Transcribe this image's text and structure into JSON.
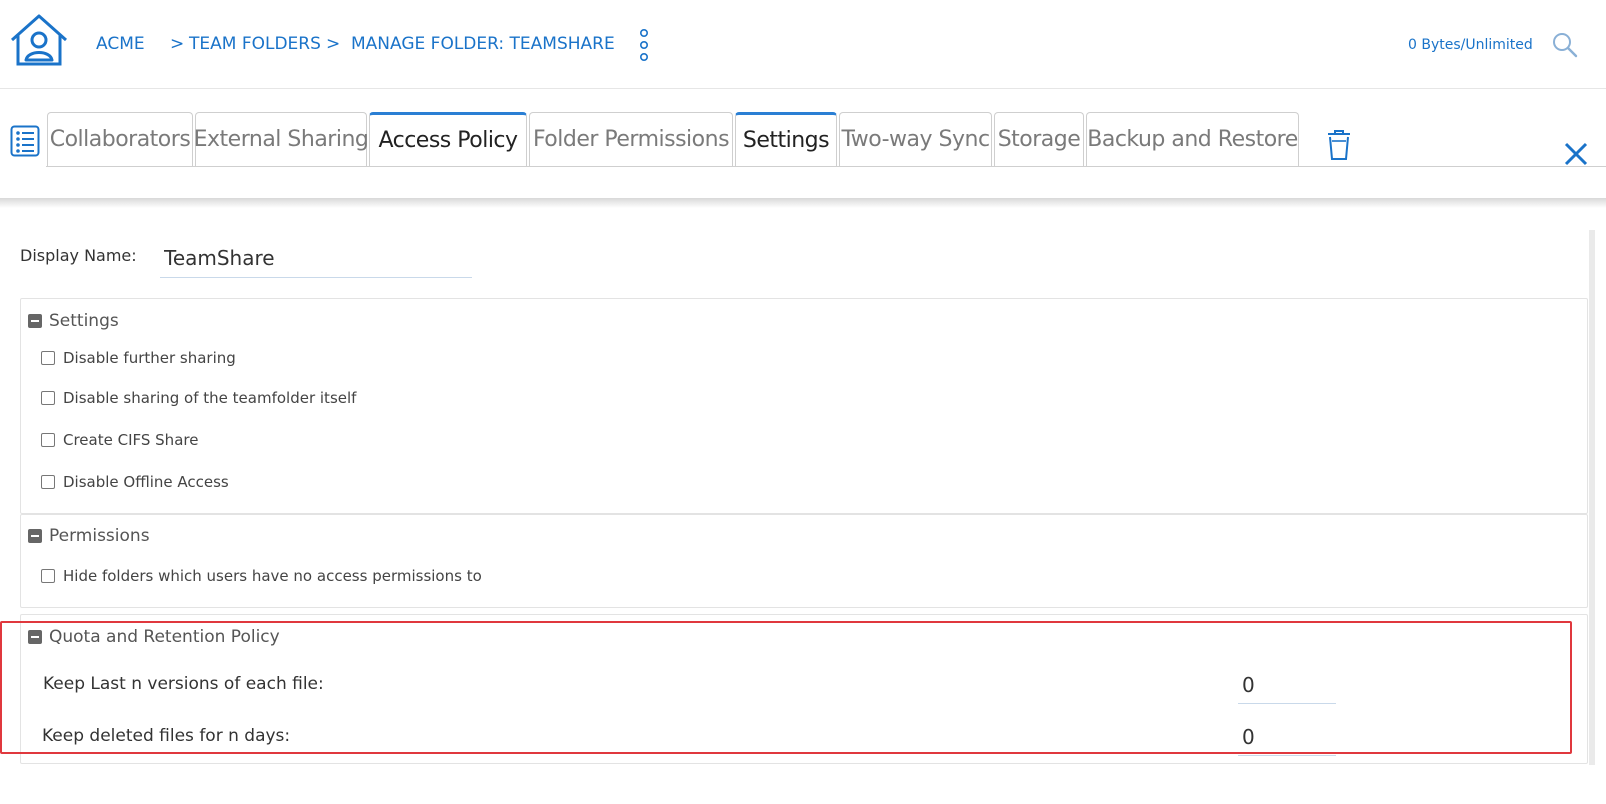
{
  "header": {
    "breadcrumb": {
      "root": "ACME",
      "sep1": ">",
      "team_folders": "TEAM FOLDERS",
      "sep2": ">",
      "current": "MANAGE FOLDER: TEAMSHARE"
    },
    "quota": "0 Bytes/Unlimited"
  },
  "tabs": [
    {
      "label": "Collaborators",
      "active": false
    },
    {
      "label": "External Sharing",
      "active": false
    },
    {
      "label": "Access Policy",
      "active": true
    },
    {
      "label": "Folder Permissions",
      "active": false
    },
    {
      "label": "Settings",
      "active": true
    },
    {
      "label": "Two-way Sync",
      "active": false
    },
    {
      "label": "Storage",
      "active": false
    },
    {
      "label": "Backup and Restore",
      "active": false
    }
  ],
  "display_name": {
    "label": "Display Name:",
    "value": "TeamShare"
  },
  "settings_panel": {
    "title": "Settings",
    "options": [
      {
        "label": "Disable further sharing",
        "checked": false
      },
      {
        "label": "Disable sharing of the teamfolder itself",
        "checked": false
      },
      {
        "label": "Create CIFS Share",
        "checked": false
      },
      {
        "label": "Disable Offline Access",
        "checked": false
      }
    ]
  },
  "permissions_panel": {
    "title": "Permissions",
    "options": [
      {
        "label": "Hide folders which users have no access permissions to",
        "checked": false
      }
    ]
  },
  "quota_panel": {
    "title": "Quota and Retention Policy",
    "fields": [
      {
        "label": "Keep Last n versions of each file:",
        "value": "0"
      },
      {
        "label": "Keep deleted files for n days:",
        "value": "0"
      }
    ]
  },
  "colors": {
    "accent": "#1a73c9",
    "highlight": "#e0383e",
    "active_tab": "#2a7fd4"
  }
}
